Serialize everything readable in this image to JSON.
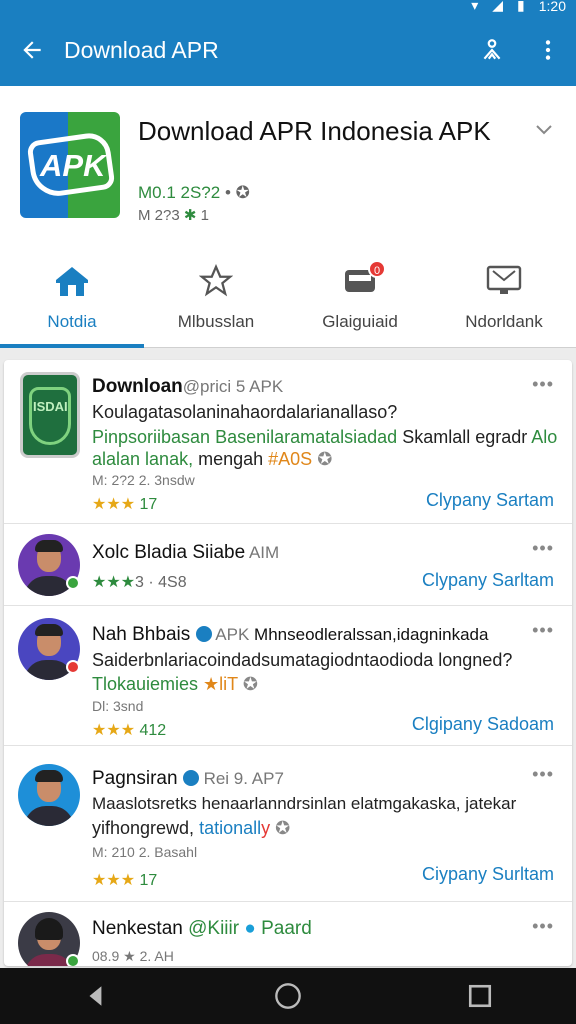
{
  "status": {
    "time": "1:20"
  },
  "appbar": {
    "title": "Download APR",
    "back_icon": "arrow-left-icon",
    "share_icon": "share-icon",
    "menu_icon": "more-vert-icon"
  },
  "header": {
    "title": "Download APR Indonesia APK",
    "logo_text": "APK",
    "meta_version": "M0.1 2S?2",
    "meta_sep": "•",
    "meta_small": "M 2?3",
    "meta_small_extra": "1"
  },
  "tabs": [
    {
      "label": "Notdia",
      "icon": "home-icon",
      "active": true
    },
    {
      "label": "Mlbusslan",
      "icon": "star-icon",
      "active": false
    },
    {
      "label": "Glaiguiaid",
      "icon": "inbox-icon",
      "active": false,
      "badge": "0"
    },
    {
      "label": "Ndorldank",
      "icon": "monitor-icon",
      "active": false
    }
  ],
  "items": [
    {
      "name": "Downloan",
      "name_suffix": "@prici 5 APK",
      "line1": "Koulagatasolaninahaordalarianallaso?",
      "line2_green": "Pinpsoriibasan Basenilaramatalsiadad",
      "line2_black": " Skamlall egradr",
      "line2_tail": " Alo",
      "line3_green": "alalan lanak,",
      "line3_black": " mengah ",
      "line3_orange": "#A0S",
      "small": "M: 2?2 2. 3nsdw",
      "stars": "★★★",
      "stars_num": "17",
      "action": "Clypany Sartam",
      "logo_text": "ISDAI"
    },
    {
      "name": "Xolc Bladia Siiabe",
      "name_suffix": " AIM",
      "stars": "★★★",
      "stars_num": "3 · 4S8",
      "action": "Clypany Sarltam"
    },
    {
      "name": "Nah Bhbais",
      "name_suffix": " APK",
      "name_tail": " Mhnseodleralssan,idagninkada",
      "line1": "Saiderbnlariacoindadsumatagiodntaodioda ",
      "line1_tail": "longned?",
      "line2_green": "Tlokauiemies",
      "line2_orange": " ★liT",
      "small": "Dl: 3snd",
      "stars": "★★★",
      "stars_num": "412",
      "action": "Clgipany Sadoam"
    },
    {
      "name": "Pagnsiran",
      "name_suffix": " Rei 9. AP7",
      "line1": "Maaslotsretks henaarlanndrsinlan elatmgakaska, jatekar",
      "line2": "yifhongrewd, ",
      "line2_green": "tationall",
      "line2_red": "y",
      "small": "M: 210 2. Basahl",
      "stars": "★★★",
      "stars_num": "17",
      "action": "Ciypany Surltam"
    },
    {
      "name": "Nenkestan",
      "name_green": " @Kiiir ",
      "name_tail": " Paard",
      "small": "08.9 ★ 2. AH"
    }
  ],
  "colors": {
    "primary": "#1a7fc1",
    "green": "#2e8b3e",
    "star": "#e6a817"
  }
}
